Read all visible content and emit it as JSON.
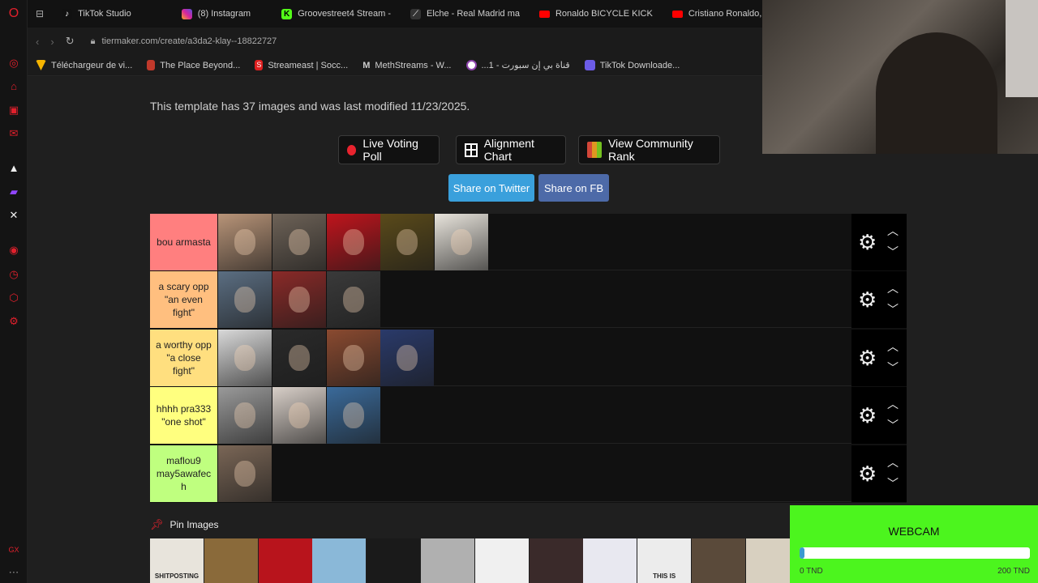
{
  "tabs": [
    {
      "label": "TikTok Studio",
      "color": "#111111"
    },
    {
      "label": "(8) Instagram",
      "color": "#d6249f"
    },
    {
      "label": "Groovestreet4 Stream -",
      "color": "#53fc18"
    },
    {
      "label": "Elche - Real Madrid ma",
      "color": "#eeeeee"
    },
    {
      "label": "Ronaldo BICYCLE KICK",
      "color": "#ff0000"
    },
    {
      "label": "Cristiano Ronaldo,",
      "color": "#ff0000"
    }
  ],
  "address": {
    "url": "tiermaker.com/create/a3da2-klay--18822727"
  },
  "bookmarks": [
    {
      "label": "Téléchargeur de vi...",
      "color": "#f5b400"
    },
    {
      "label": "The Place Beyond...",
      "color": "#c0392b"
    },
    {
      "label": "Streameast | Socc...",
      "color": "#e02020"
    },
    {
      "label": "MethStreams - W...",
      "color": "#cccccc"
    },
    {
      "label": "...1 - قناة بي إن سبورت",
      "color": "#8e44ad"
    },
    {
      "label": "TikTok Downloade...",
      "color": "#6c5ce7"
    }
  ],
  "info": "This template has 37 images and was last modified 11/23/2025.",
  "buttons": {
    "live_poll": "Live Voting Poll",
    "alignment": "Alignment Chart",
    "community": "View Community Rank"
  },
  "share": {
    "twitter": "Share on Twitter",
    "fb": "Share on FB"
  },
  "tiers": [
    {
      "label": "bou armasta",
      "color": "#ff7f7f",
      "items": [
        {
          "name": "bearded-man-photo",
          "color": "#b89478"
        },
        {
          "name": "young-man-photo",
          "color": "#6d6257"
        },
        {
          "name": "rapper-red-background",
          "color": "#c0141c"
        },
        {
          "name": "gold-emblem",
          "color": "#5a4a1a"
        },
        {
          "name": "tunisia-parliament-logo",
          "color": "#e8e4dc"
        }
      ]
    },
    {
      "label": "a scary opp\n\"an even\nfight\"",
      "color": "#ffbf7f",
      "items": [
        {
          "name": "older-man-photo",
          "color": "#5b6e82"
        },
        {
          "name": "red-haired-woman-photo",
          "color": "#8a2a28"
        },
        {
          "name": "bald-man-photo",
          "color": "#3a3a3a"
        }
      ]
    },
    {
      "label": "a worthy opp\n\"a close\nfight\"",
      "color": "#ffdf7f",
      "items": [
        {
          "name": "curly-haired-man-photo",
          "color": "#d9d9d9"
        },
        {
          "name": "man-sunglasses-photo",
          "color": "#2a2a2a"
        },
        {
          "name": "man-cap-photo",
          "color": "#8a4a30"
        },
        {
          "name": "man-blue-background-photo",
          "color": "#2a3a6a"
        }
      ]
    },
    {
      "label": "hhhh pra333\n\"one shot\"",
      "color": "#ffff7f",
      "items": [
        {
          "name": "elderly-man-photo",
          "color": "#9a9a9a"
        },
        {
          "name": "blonde-woman-photo",
          "color": "#d8cfc8"
        },
        {
          "name": "man-blue-jacket-photo",
          "color": "#3a6a9a"
        }
      ]
    },
    {
      "label": "maflou9\nmay5awafec\nh",
      "color": "#bfff7f",
      "items": [
        {
          "name": "young-man-portrait-photo",
          "color": "#7a6656"
        }
      ]
    }
  ],
  "pin_label": "Pin Images",
  "pins": [
    {
      "name": "shitposting-logo",
      "color": "#e8e4dc",
      "text": "SHITPOSTING"
    },
    {
      "name": "tv-image",
      "color": "#8a6a3a",
      "text": ""
    },
    {
      "name": "esperance-logo",
      "color": "#b8141c",
      "text": ""
    },
    {
      "name": "tunisia-map",
      "color": "#8ab8d8",
      "text": ""
    },
    {
      "name": "dark-text-image",
      "color": "#1a1a1a",
      "text": ""
    },
    {
      "name": "bw-man-photo",
      "color": "#b0b0b0",
      "text": ""
    },
    {
      "name": "brigade-rouge-logo",
      "color": "#f0f0f0",
      "text": ""
    },
    {
      "name": "arabic-text-image",
      "color": "#3a2a2a",
      "text": ""
    },
    {
      "name": "round-logo",
      "color": "#e8e8f0",
      "text": ""
    },
    {
      "name": "this-is-image",
      "color": "#ececec",
      "text": "THIS IS"
    },
    {
      "name": "man-suit-photo",
      "color": "#5a4a3a",
      "text": ""
    },
    {
      "name": "map-fragment",
      "color": "#d8d0c0",
      "text": ""
    }
  ],
  "donation": {
    "title": "WEBCAM",
    "progress": 0.02,
    "min": "0 TND",
    "max": "200 TND"
  }
}
